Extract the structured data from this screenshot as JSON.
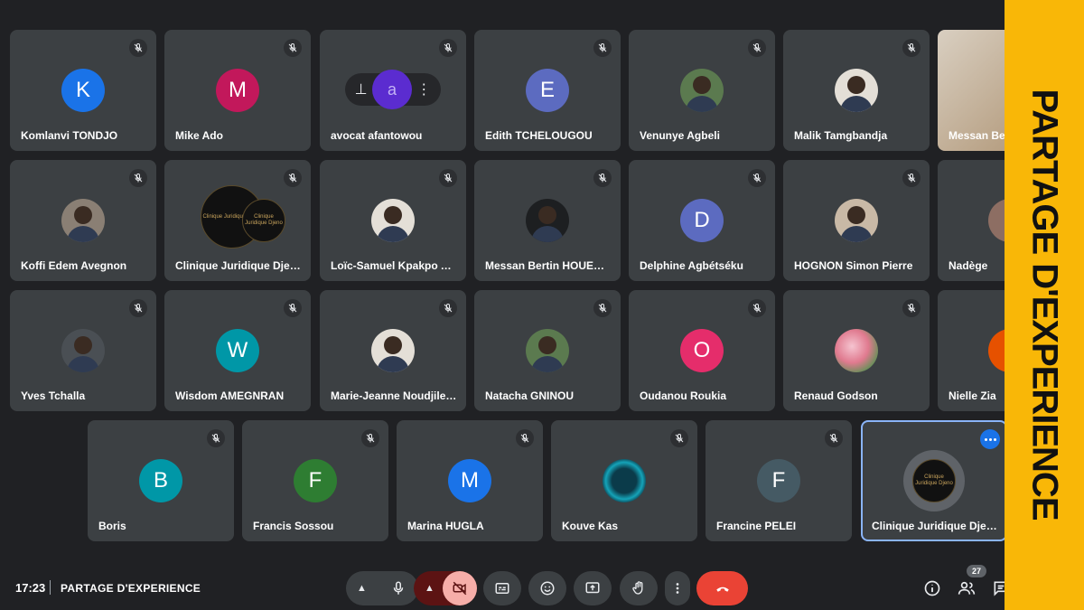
{
  "participants_row1": [
    {
      "name": "Komlanvi TONDJO",
      "initial": "K",
      "color": "#1a73e8"
    },
    {
      "name": "Mike Ado",
      "initial": "M",
      "color": "#c2185b"
    },
    {
      "name": "avocat afantowou",
      "initial": "a",
      "color": "#5b2cd0"
    },
    {
      "name": "Edith TCHELOUGOU",
      "initial": "E",
      "color": "#5c6bc0"
    },
    {
      "name": "Venunye Agbeli",
      "initial": "",
      "color": ""
    },
    {
      "name": "Malik Tamgbandja",
      "initial": "",
      "color": ""
    },
    {
      "name": "Messan Ber",
      "initial": "",
      "color": ""
    }
  ],
  "participants_row2": [
    {
      "name": "Koffi Edem Avegnon"
    },
    {
      "name": "Clinique Juridique Djena..."
    },
    {
      "name": "Loïc-Samuel Kpakpo AK..."
    },
    {
      "name": "Messan Bertin HOUESS..."
    },
    {
      "name": "Delphine Agbétséku",
      "initial": "D",
      "color": "#5c6bc0"
    },
    {
      "name": "HOGNON Simon Pierre"
    },
    {
      "name": "Nadège"
    }
  ],
  "participants_row3": [
    {
      "name": "Yves Tchalla"
    },
    {
      "name": "Wisdom AMEGNRAN",
      "initial": "W",
      "color": "#0097a7"
    },
    {
      "name": "Marie-Jeanne Noudjilel..."
    },
    {
      "name": "Natacha GNINOU"
    },
    {
      "name": "Oudanou Roukia",
      "initial": "O",
      "color": "#e52d6b"
    },
    {
      "name": "Renaud Godson"
    },
    {
      "name": "Nielle Zia"
    }
  ],
  "participants_row4": [
    {
      "name": "Boris",
      "initial": "B",
      "color": "#0097a7"
    },
    {
      "name": "Francis Sossou",
      "initial": "F",
      "color": "#2e7d32"
    },
    {
      "name": "Marina HUGLA",
      "initial": "M",
      "color": "#1a73e8"
    },
    {
      "name": "Kouve Kas"
    },
    {
      "name": "Francine PELEI",
      "initial": "F",
      "color": "#455a64"
    },
    {
      "name": "Clinique Juridique Djen..."
    }
  ],
  "logo_text": "Clinique Juridique Djeno",
  "banner": {
    "text": "PARTAGE D'EXPERIENCE",
    "color": "#f9b707"
  },
  "footer": {
    "time": "17:23",
    "meeting_title": "PARTAGE D'EXPERIENCE",
    "participant_count": "27"
  },
  "pin_menu": {
    "pin_glyph": "⊥",
    "more_glyph": "⋮"
  },
  "colors": {
    "background": "#202124",
    "tile": "#3c4043",
    "end_call": "#ea4335",
    "camera_off": "#f6aea9",
    "speaking": "#1a73e8"
  }
}
